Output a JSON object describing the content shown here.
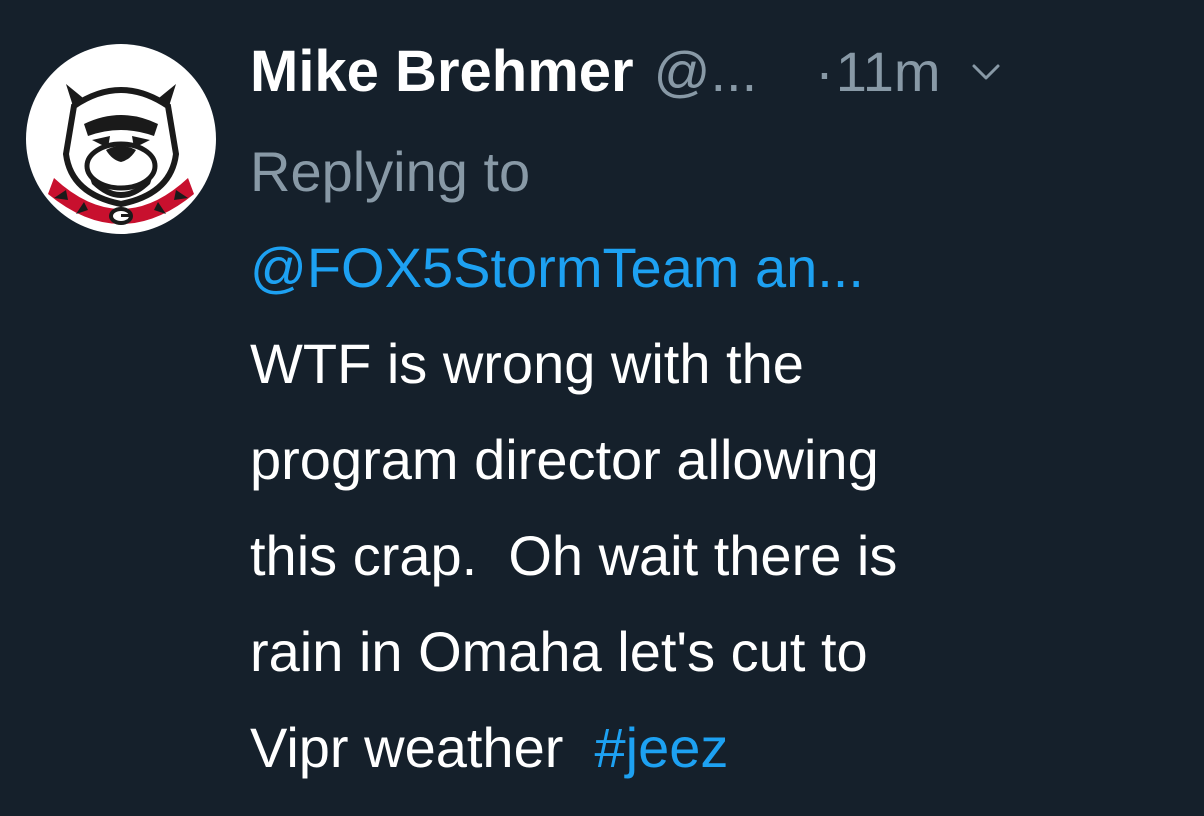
{
  "tweet": {
    "display_name": "Mike Brehmer",
    "handle": "@...",
    "dot": "·",
    "time": "11m",
    "replying_label": "Replying to",
    "mention": "@FOX5StormTeam an...",
    "body_lines": [
      "WTF is wrong with the",
      "program director allowing",
      "this crap.  Oh wait there is",
      "rain in Omaha let's cut to"
    ],
    "last_line_text": "Vipr weather  ",
    "hashtag": "#jeez",
    "avatar_icon": "bulldog-logo-icon",
    "chevron_icon": "chevron-down-icon"
  },
  "colors": {
    "background": "#15202b",
    "primary_text": "#ffffff",
    "secondary_text": "#8899a6",
    "link": "#1da1f2",
    "collar_red": "#c8102e"
  }
}
